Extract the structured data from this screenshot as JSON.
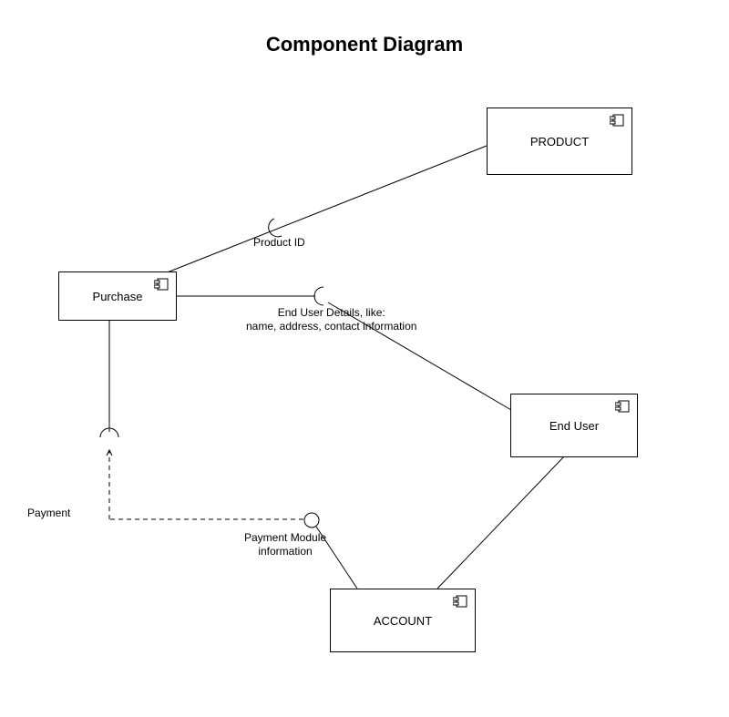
{
  "title": "Component Diagram",
  "components": {
    "product": "PRODUCT",
    "purchase": "Purchase",
    "end_user": "End User",
    "account": "ACCOUNT"
  },
  "connectors": {
    "product_id": "Product ID",
    "end_user_details": "End User Details, like:\nname, address, contact information",
    "payment": "Payment",
    "payment_module": "Payment Module\ninformation"
  }
}
